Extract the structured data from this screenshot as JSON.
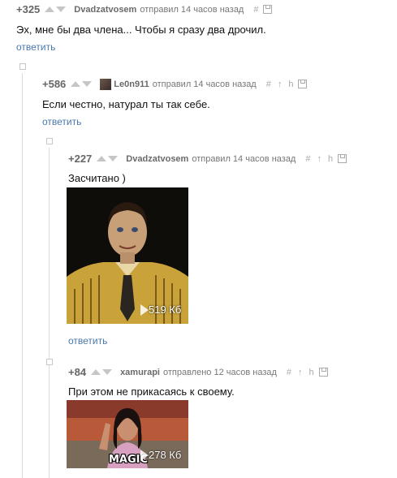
{
  "reply_label": "ответить",
  "comments": [
    {
      "rating": "+325",
      "user": "Dvadzatvosem",
      "action": "отправил",
      "time": "14 часов назад",
      "text": "Эх, мне бы два члена... Чтобы я сразу два дрочил."
    },
    {
      "rating": "+586",
      "user": "Le0n911",
      "action": "отправил",
      "time": "14 часов назад",
      "text": "Если честно, натурал ты так себе."
    },
    {
      "rating": "+227",
      "user": "Dvadzatvosem",
      "action": "отправил",
      "time": "14 часов назад",
      "text": "Засчитано )",
      "attachment": {
        "size": "519 Кб",
        "kind": "gif"
      }
    },
    {
      "rating": "+84",
      "user": "xamurapi",
      "action": "отправлено",
      "time": "12 часов назад",
      "text": "При этом  не прикасаясь к своему.",
      "attachment": {
        "size": "278 Кб",
        "kind": "gif",
        "caption": "MAGIC"
      }
    }
  ],
  "icons": {
    "hash": "#",
    "pin": "↑",
    "hand": "h",
    "save": "save-icon"
  }
}
